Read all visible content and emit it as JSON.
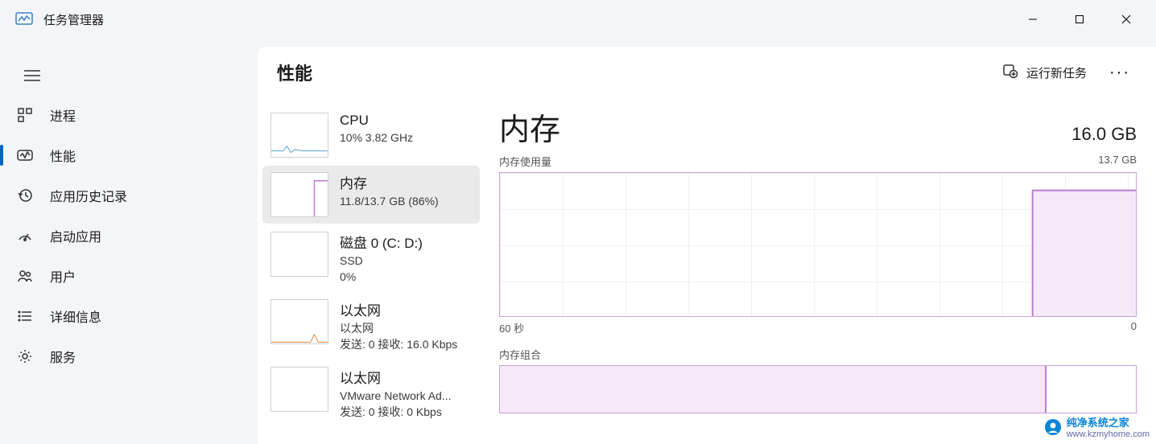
{
  "app": {
    "title": "任务管理器"
  },
  "window_controls": {
    "min": "minimize",
    "max": "maximize",
    "close": "close"
  },
  "nav": {
    "items": [
      {
        "label": "进程"
      },
      {
        "label": "性能"
      },
      {
        "label": "应用历史记录"
      },
      {
        "label": "启动应用"
      },
      {
        "label": "用户"
      },
      {
        "label": "详细信息"
      },
      {
        "label": "服务"
      }
    ]
  },
  "header": {
    "title": "性能",
    "run_task": "运行新任务"
  },
  "perf_list": [
    {
      "title": "CPU",
      "sub": "10% 3.82 GHz"
    },
    {
      "title": "内存",
      "sub": "11.8/13.7 GB (86%)"
    },
    {
      "title": "磁盘 0 (C: D:)",
      "sub": "SSD",
      "sub2": "0%"
    },
    {
      "title": "以太网",
      "sub": "以太网",
      "sub2": "发送: 0 接收: 16.0 Kbps"
    },
    {
      "title": "以太网",
      "sub": "VMware Network Ad...",
      "sub2": "发送: 0 接收: 0 Kbps"
    }
  ],
  "detail": {
    "title": "内存",
    "total": "16.0 GB",
    "usage_label": "内存使用量",
    "usage_max": "13.7 GB",
    "x_left": "60 秒",
    "x_right": "0",
    "comp_label": "内存组合"
  },
  "chart_data": {
    "type": "line",
    "title": "内存使用量",
    "xlabel": "秒",
    "ylabel": "GB",
    "x_range_seconds": [
      60,
      0
    ],
    "ylim_gb": [
      0,
      13.7
    ],
    "series": [
      {
        "name": "内存使用量 (GB)",
        "x_seconds": [
          60,
          55,
          50,
          45,
          40,
          35,
          30,
          25,
          20,
          15,
          10,
          8,
          6,
          4,
          2,
          0
        ],
        "y_gb": [
          0,
          0,
          0,
          0,
          0,
          0,
          0,
          0,
          0,
          0,
          0,
          0,
          11.8,
          11.8,
          11.8,
          11.8
        ]
      }
    ],
    "composition_bar": {
      "total_gb": 13.7,
      "used_gb": 11.8,
      "used_percent": 86
    }
  },
  "watermark": {
    "text": "纯净系统之家",
    "url": "www.kzmyhome.com"
  }
}
